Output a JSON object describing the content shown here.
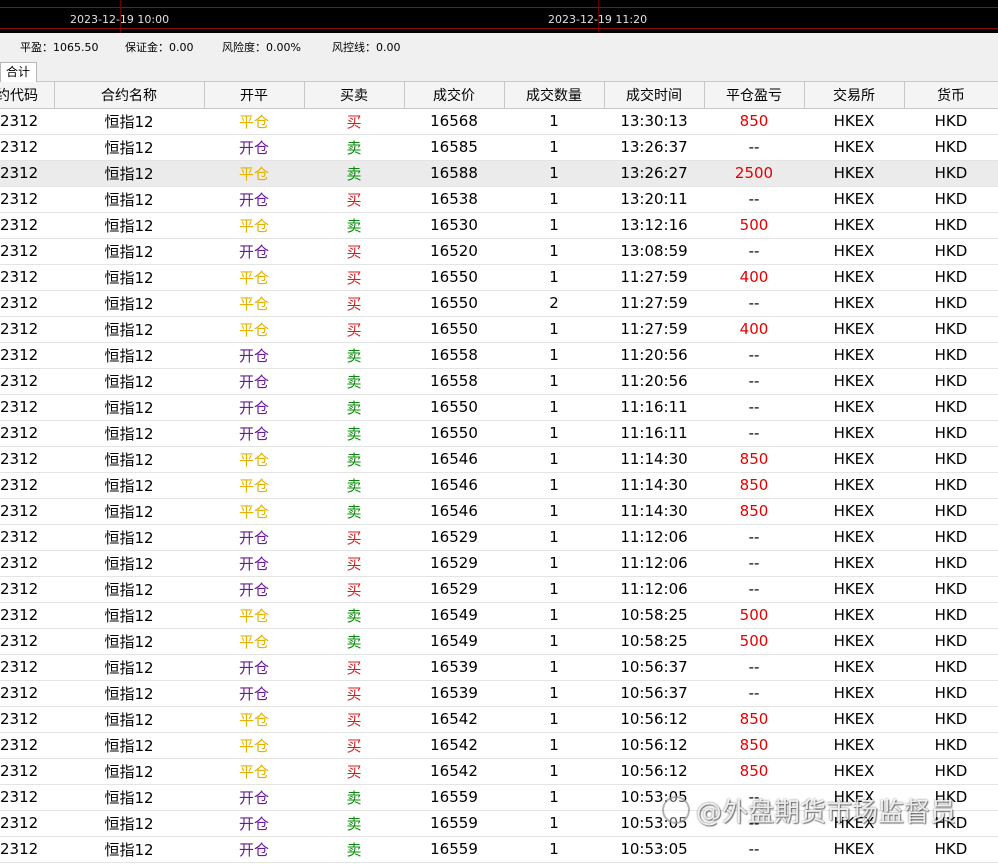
{
  "chart_strip": {
    "times": [
      "2023-12-19 10:00",
      "2023-12-19 11:20"
    ]
  },
  "summary": {
    "items": [
      "平盈：1065.50",
      "保证金：0.00",
      "风险度：0.00%",
      "风控线：0.00"
    ]
  },
  "tabs": [
    {
      "label": "合计"
    }
  ],
  "table": {
    "headers": [
      "约代码",
      "合约名称",
      "开平",
      "买卖",
      "成交价",
      "成交数量",
      "成交时间",
      "平仓盈亏",
      "交易所",
      "货币"
    ],
    "rows": [
      {
        "code": "2312",
        "name": "恒指12",
        "oc": "平仓",
        "bs": "买",
        "price": "16568",
        "qty": "1",
        "time": "13:30:13",
        "pnl": "850",
        "exch": "HKEX",
        "cur": "HKD"
      },
      {
        "code": "2312",
        "name": "恒指12",
        "oc": "开仓",
        "bs": "卖",
        "price": "16585",
        "qty": "1",
        "time": "13:26:37",
        "pnl": "--",
        "exch": "HKEX",
        "cur": "HKD"
      },
      {
        "code": "2312",
        "name": "恒指12",
        "oc": "平仓",
        "bs": "卖",
        "price": "16588",
        "qty": "1",
        "time": "13:26:27",
        "pnl": "2500",
        "exch": "HKEX",
        "cur": "HKD"
      },
      {
        "code": "2312",
        "name": "恒指12",
        "oc": "开仓",
        "bs": "买",
        "price": "16538",
        "qty": "1",
        "time": "13:20:11",
        "pnl": "--",
        "exch": "HKEX",
        "cur": "HKD"
      },
      {
        "code": "2312",
        "name": "恒指12",
        "oc": "平仓",
        "bs": "卖",
        "price": "16530",
        "qty": "1",
        "time": "13:12:16",
        "pnl": "500",
        "exch": "HKEX",
        "cur": "HKD"
      },
      {
        "code": "2312",
        "name": "恒指12",
        "oc": "开仓",
        "bs": "买",
        "price": "16520",
        "qty": "1",
        "time": "13:08:59",
        "pnl": "--",
        "exch": "HKEX",
        "cur": "HKD"
      },
      {
        "code": "2312",
        "name": "恒指12",
        "oc": "平仓",
        "bs": "买",
        "price": "16550",
        "qty": "1",
        "time": "11:27:59",
        "pnl": "400",
        "exch": "HKEX",
        "cur": "HKD"
      },
      {
        "code": "2312",
        "name": "恒指12",
        "oc": "平仓",
        "bs": "买",
        "price": "16550",
        "qty": "2",
        "time": "11:27:59",
        "pnl": "--",
        "exch": "HKEX",
        "cur": "HKD"
      },
      {
        "code": "2312",
        "name": "恒指12",
        "oc": "平仓",
        "bs": "买",
        "price": "16550",
        "qty": "1",
        "time": "11:27:59",
        "pnl": "400",
        "exch": "HKEX",
        "cur": "HKD"
      },
      {
        "code": "2312",
        "name": "恒指12",
        "oc": "开仓",
        "bs": "卖",
        "price": "16558",
        "qty": "1",
        "time": "11:20:56",
        "pnl": "--",
        "exch": "HKEX",
        "cur": "HKD"
      },
      {
        "code": "2312",
        "name": "恒指12",
        "oc": "开仓",
        "bs": "卖",
        "price": "16558",
        "qty": "1",
        "time": "11:20:56",
        "pnl": "--",
        "exch": "HKEX",
        "cur": "HKD"
      },
      {
        "code": "2312",
        "name": "恒指12",
        "oc": "开仓",
        "bs": "卖",
        "price": "16550",
        "qty": "1",
        "time": "11:16:11",
        "pnl": "--",
        "exch": "HKEX",
        "cur": "HKD"
      },
      {
        "code": "2312",
        "name": "恒指12",
        "oc": "开仓",
        "bs": "卖",
        "price": "16550",
        "qty": "1",
        "time": "11:16:11",
        "pnl": "--",
        "exch": "HKEX",
        "cur": "HKD"
      },
      {
        "code": "2312",
        "name": "恒指12",
        "oc": "平仓",
        "bs": "卖",
        "price": "16546",
        "qty": "1",
        "time": "11:14:30",
        "pnl": "850",
        "exch": "HKEX",
        "cur": "HKD"
      },
      {
        "code": "2312",
        "name": "恒指12",
        "oc": "平仓",
        "bs": "卖",
        "price": "16546",
        "qty": "1",
        "time": "11:14:30",
        "pnl": "850",
        "exch": "HKEX",
        "cur": "HKD"
      },
      {
        "code": "2312",
        "name": "恒指12",
        "oc": "平仓",
        "bs": "卖",
        "price": "16546",
        "qty": "1",
        "time": "11:14:30",
        "pnl": "850",
        "exch": "HKEX",
        "cur": "HKD"
      },
      {
        "code": "2312",
        "name": "恒指12",
        "oc": "开仓",
        "bs": "买",
        "price": "16529",
        "qty": "1",
        "time": "11:12:06",
        "pnl": "--",
        "exch": "HKEX",
        "cur": "HKD"
      },
      {
        "code": "2312",
        "name": "恒指12",
        "oc": "开仓",
        "bs": "买",
        "price": "16529",
        "qty": "1",
        "time": "11:12:06",
        "pnl": "--",
        "exch": "HKEX",
        "cur": "HKD"
      },
      {
        "code": "2312",
        "name": "恒指12",
        "oc": "开仓",
        "bs": "买",
        "price": "16529",
        "qty": "1",
        "time": "11:12:06",
        "pnl": "--",
        "exch": "HKEX",
        "cur": "HKD"
      },
      {
        "code": "2312",
        "name": "恒指12",
        "oc": "平仓",
        "bs": "卖",
        "price": "16549",
        "qty": "1",
        "time": "10:58:25",
        "pnl": "500",
        "exch": "HKEX",
        "cur": "HKD"
      },
      {
        "code": "2312",
        "name": "恒指12",
        "oc": "平仓",
        "bs": "卖",
        "price": "16549",
        "qty": "1",
        "time": "10:58:25",
        "pnl": "500",
        "exch": "HKEX",
        "cur": "HKD"
      },
      {
        "code": "2312",
        "name": "恒指12",
        "oc": "开仓",
        "bs": "买",
        "price": "16539",
        "qty": "1",
        "time": "10:56:37",
        "pnl": "--",
        "exch": "HKEX",
        "cur": "HKD"
      },
      {
        "code": "2312",
        "name": "恒指12",
        "oc": "开仓",
        "bs": "买",
        "price": "16539",
        "qty": "1",
        "time": "10:56:37",
        "pnl": "--",
        "exch": "HKEX",
        "cur": "HKD"
      },
      {
        "code": "2312",
        "name": "恒指12",
        "oc": "平仓",
        "bs": "买",
        "price": "16542",
        "qty": "1",
        "time": "10:56:12",
        "pnl": "850",
        "exch": "HKEX",
        "cur": "HKD"
      },
      {
        "code": "2312",
        "name": "恒指12",
        "oc": "平仓",
        "bs": "买",
        "price": "16542",
        "qty": "1",
        "time": "10:56:12",
        "pnl": "850",
        "exch": "HKEX",
        "cur": "HKD"
      },
      {
        "code": "2312",
        "name": "恒指12",
        "oc": "平仓",
        "bs": "买",
        "price": "16542",
        "qty": "1",
        "time": "10:56:12",
        "pnl": "850",
        "exch": "HKEX",
        "cur": "HKD"
      },
      {
        "code": "2312",
        "name": "恒指12",
        "oc": "开仓",
        "bs": "卖",
        "price": "16559",
        "qty": "1",
        "time": "10:53:05",
        "pnl": "--",
        "exch": "HKEX",
        "cur": "HKD"
      },
      {
        "code": "2312",
        "name": "恒指12",
        "oc": "开仓",
        "bs": "卖",
        "price": "16559",
        "qty": "1",
        "time": "10:53:05",
        "pnl": "--",
        "exch": "HKEX",
        "cur": "HKD"
      },
      {
        "code": "2312",
        "name": "恒指12",
        "oc": "开仓",
        "bs": "卖",
        "price": "16559",
        "qty": "1",
        "time": "10:53:05",
        "pnl": "--",
        "exch": "HKEX",
        "cur": "HKD"
      }
    ],
    "highlighted_row": 2
  },
  "colors": {
    "open": "#6a1b9a",
    "close": "#e4b200",
    "buy": "#d81f1f",
    "sell": "#0a8a0a",
    "pnl_positive": "#e30000",
    "highlight_bg": "#ebebeb",
    "chart_bg": "#000000"
  },
  "watermark": {
    "icon": "at-sign-logo-icon",
    "text": "@外盘期货市场监督员"
  }
}
